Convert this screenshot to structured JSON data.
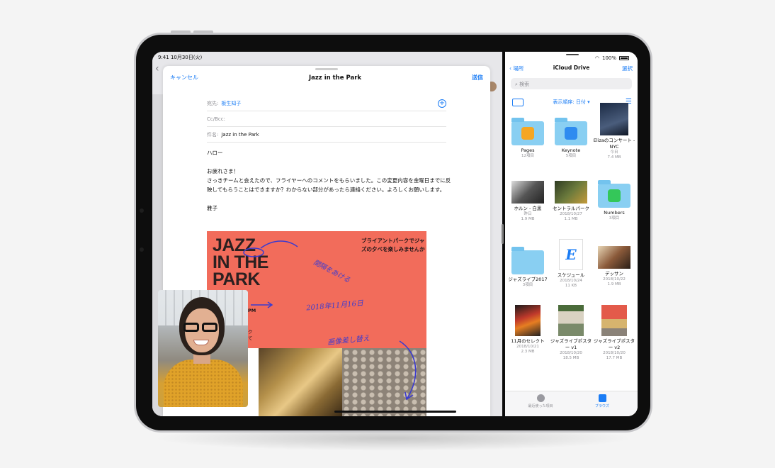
{
  "status": {
    "time_date": "9:41  10月30日(火)",
    "battery": "100%"
  },
  "mail": {
    "cancel": "キャンセル",
    "title": "Jazz in the Park",
    "send": "送信",
    "to_label": "宛先:",
    "to_value": "板生知子",
    "ccbcc_label": "Cc/Bcc:",
    "subject_label": "件名:",
    "subject_value": "Jazz in the Park",
    "body": {
      "greeting": "ハロー",
      "line1": "お疲れさま！",
      "line2": "さっきチームと会えたので、フライヤーへのコメントをもらいました。この変更内容を金曜日までに反映してもらうことはできますか？わからない部分があったら連絡ください。よろしくお願いします。",
      "signature": "雅子"
    }
  },
  "poster": {
    "headline": "JAZZ\nIN THE\nPARK",
    "jp_text": "ブライアントパークでジャズの夕べを楽しみませんか",
    "pm": "PM",
    "te": "ク\nて",
    "note_spacing": "間隔をあける",
    "note_date": "2018年11月16日",
    "note_replace": "画像差し替え"
  },
  "files": {
    "back": "場所",
    "title": "iCloud Drive",
    "select": "選択",
    "search_placeholder": "検索",
    "sort": "表示順序: 日付 ▾",
    "items": [
      {
        "name": "Pages",
        "meta1": "12項目",
        "meta2": ""
      },
      {
        "name": "Keynote",
        "meta1": "5項目",
        "meta2": ""
      },
      {
        "name": "Elizaのコンサート - NYC",
        "meta1": "今日",
        "meta2": "7.4 MB"
      },
      {
        "name": "ホルン - 白黒",
        "meta1": "昨日",
        "meta2": "1.9 MB"
      },
      {
        "name": "セントラルパーク",
        "meta1": "2018/10/27",
        "meta2": "1.1 MB"
      },
      {
        "name": "Numbers",
        "meta1": "3項目",
        "meta2": ""
      },
      {
        "name": "ジャズライブ2017",
        "meta1": "3項目",
        "meta2": ""
      },
      {
        "name": "スケジュール",
        "meta1": "2018/10/24",
        "meta2": "11 KB"
      },
      {
        "name": "デッサン",
        "meta1": "2018/10/22",
        "meta2": "1.9 MB"
      },
      {
        "name": "11月のセレクト",
        "meta1": "2018/10/21",
        "meta2": "2.3 MB"
      },
      {
        "name": "ジャズライブポスター v1",
        "meta1": "2018/10/20",
        "meta2": "18.5 MB"
      },
      {
        "name": "ジャズライブポスター v2",
        "meta1": "2018/10/20",
        "meta2": "17.7 MB"
      }
    ],
    "tabs": {
      "recents": "最近使った項目",
      "browse": "ブラウズ"
    }
  },
  "colors": {
    "accent": "#1a7cf5",
    "folder": "#89cff2",
    "poster": "#f26c5b",
    "annotation": "#3b3bd0"
  }
}
